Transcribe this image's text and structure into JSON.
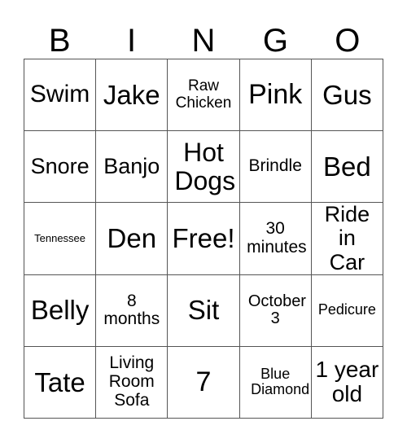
{
  "header": [
    "B",
    "I",
    "N",
    "G",
    "O"
  ],
  "cells": [
    "Swim",
    "Jake",
    "Raw Chicken",
    "Pink",
    "Gus",
    "Snore",
    "Banjo",
    "Hot Dogs",
    "Brindle",
    "Bed",
    "Tennessee",
    "Den",
    "Free!",
    "30 minutes",
    "Ride in Car",
    "Belly",
    "8 months",
    "Sit",
    "October 3",
    "Pedicure",
    "Tate",
    "Living Room Sofa",
    "7",
    "Blue Diamond",
    "1 year old"
  ]
}
